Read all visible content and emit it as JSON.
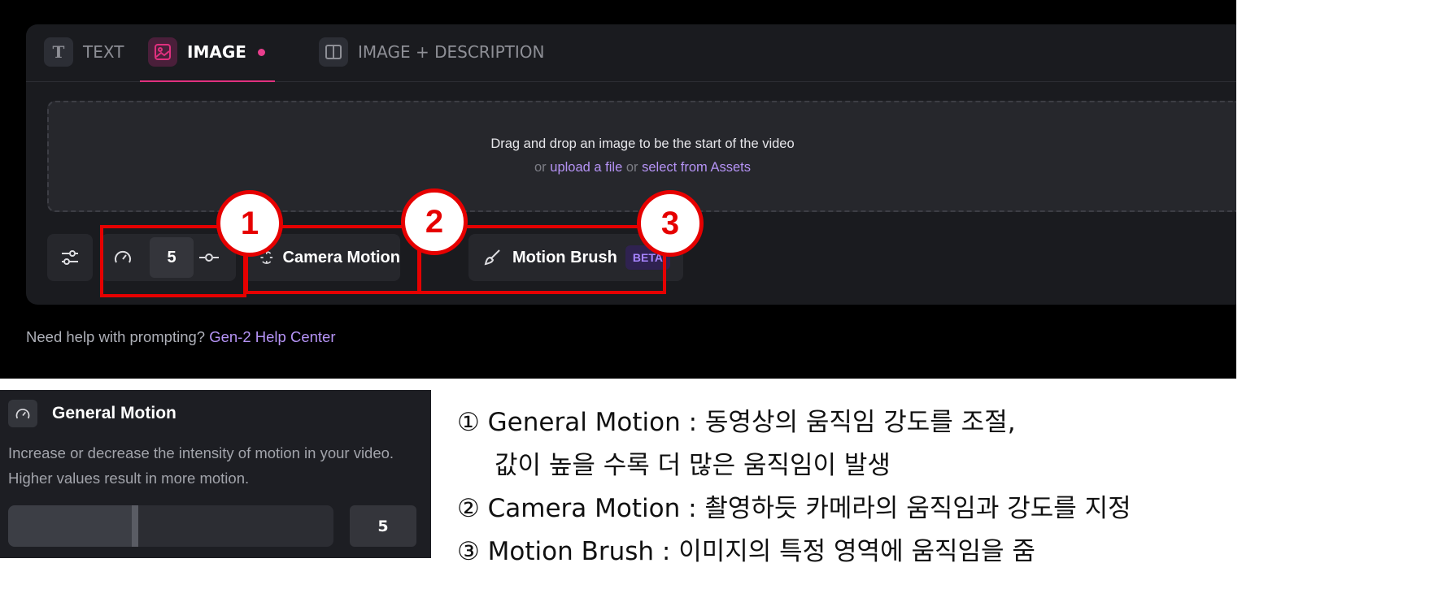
{
  "tabs": [
    {
      "label": "TEXT",
      "icon": "text-icon",
      "glyph": "T"
    },
    {
      "label": "IMAGE",
      "icon": "image-icon",
      "active": true
    },
    {
      "label": "IMAGE + DESCRIPTION",
      "icon": "split-layout-icon"
    }
  ],
  "dropzone": {
    "line1": "Drag and drop an image to be the start of the video",
    "or1": "or ",
    "upload_link": "upload a file",
    "or2": " or ",
    "assets_link": "select from Assets"
  },
  "toolbar": {
    "general_motion_value": "5",
    "camera_motion_label": "Camera Motion",
    "motion_brush_label": "Motion Brush",
    "beta_badge": "BETA"
  },
  "help": {
    "text": "Need help with prompting? ",
    "link": "Gen-2 Help Center"
  },
  "annotations": [
    "1",
    "2",
    "3"
  ],
  "inset": {
    "title": "General Motion",
    "description": "Increase or decrease the intensity of motion in your video. Higher values result in more motion.",
    "value": "5",
    "slider_fraction": 0.4
  },
  "notes": [
    "① General Motion : 동영상의 움직임 강도를 조절,",
    "값이 높을 수록 더 많은 움직임이 발생",
    "② Camera Motion : 촬영하듯 카메라의 움직임과 강도를 지정",
    "③ Motion Brush : 이미지의 특정 영역에 움직임을 줌"
  ],
  "colors": {
    "accent_pink": "#e83e8c",
    "link_purple": "#b593f5",
    "annotation_red": "#e60000",
    "panel": "#1a1b1f"
  }
}
